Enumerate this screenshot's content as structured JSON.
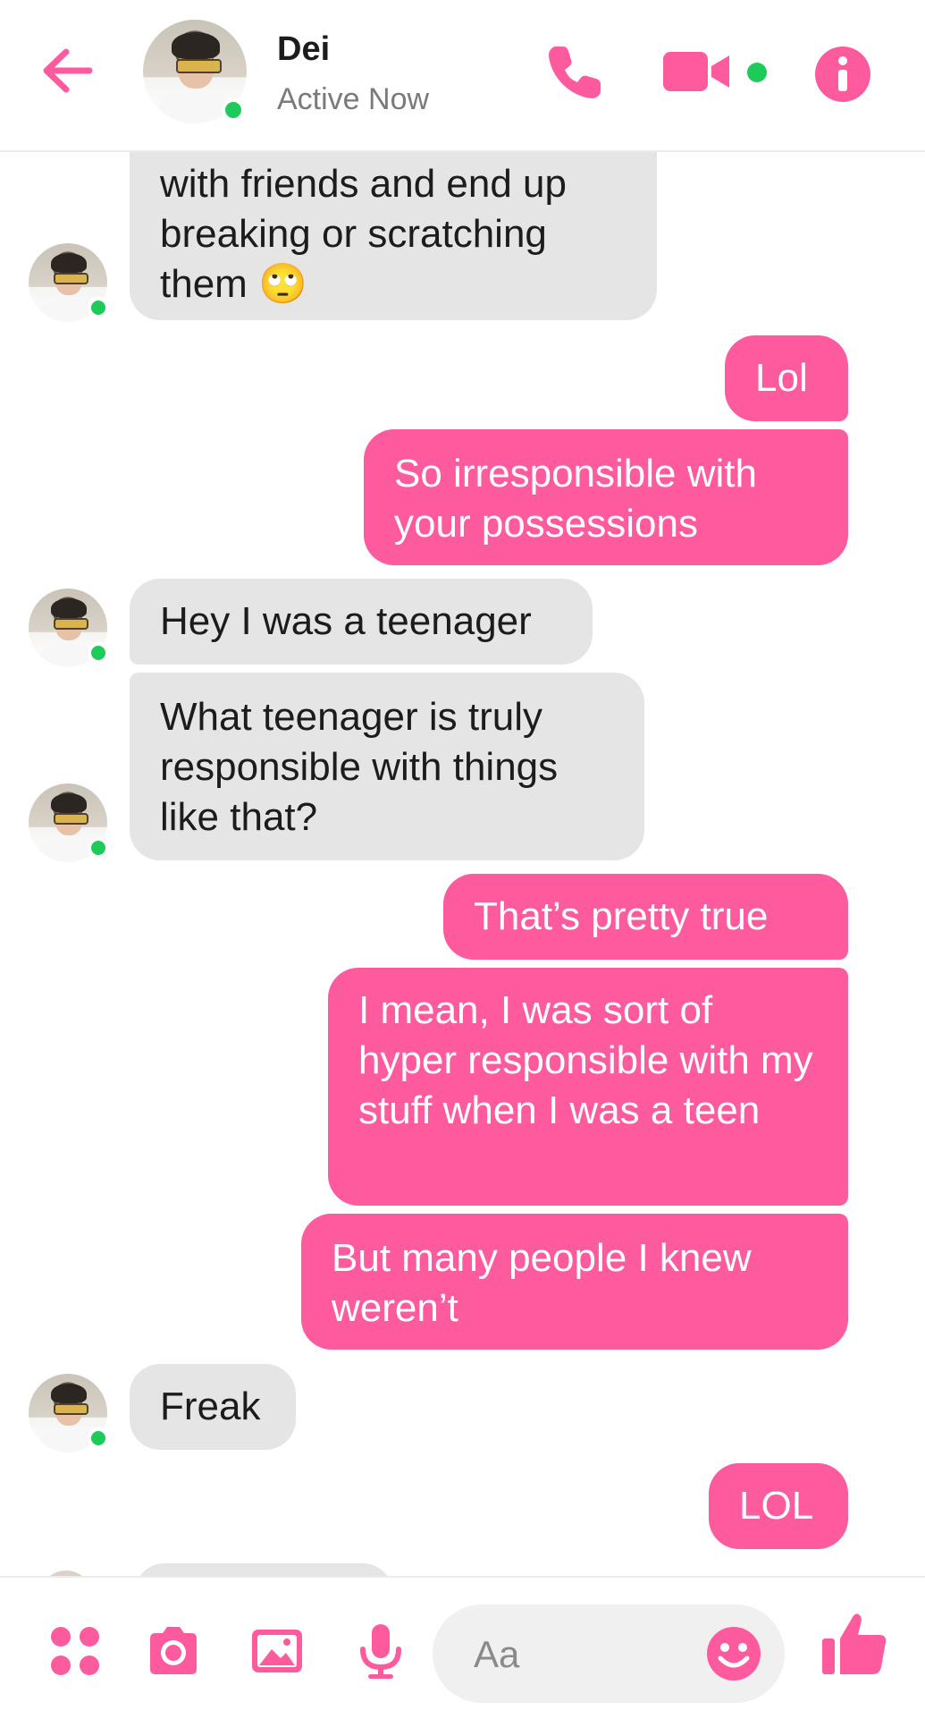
{
  "header": {
    "contact_name": "Dei",
    "status": "Active Now"
  },
  "messages": [
    {
      "from": "them",
      "text": "with friends and end up breaking or scratching them 🙄"
    },
    {
      "from": "me",
      "text": "Lol"
    },
    {
      "from": "me",
      "text": "So irresponsible with your possessions"
    },
    {
      "from": "them",
      "text": "Hey I was a teenager"
    },
    {
      "from": "them",
      "text": "What teenager is truly responsible with things like that?"
    },
    {
      "from": "me",
      "text": "That’s pretty true"
    },
    {
      "from": "me",
      "text": "I mean, I was sort of hyper responsible with my stuff when I was a teen"
    },
    {
      "from": "me",
      "text": "But many people I knew weren’t"
    },
    {
      "from": "them",
      "text": "Freak"
    },
    {
      "from": "me",
      "text": "LOL"
    }
  ],
  "composer": {
    "placeholder": "Aa"
  },
  "colors": {
    "accent": "#fe5b9f",
    "incoming_bubble": "#e5e5e5",
    "online": "#1ecb5a"
  },
  "icons": {
    "back": "arrow-left-icon",
    "call": "phone-icon",
    "video": "video-camera-icon",
    "info": "info-icon",
    "menu": "four-dots-icon",
    "camera": "camera-icon",
    "gallery": "image-icon",
    "voice": "microphone-icon",
    "emoji": "smiley-icon",
    "like": "thumbs-up-icon"
  }
}
